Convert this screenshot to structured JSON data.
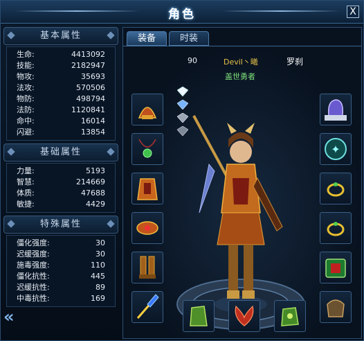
{
  "window": {
    "title": "角色",
    "close_label": "X"
  },
  "basic_attrs": {
    "header": "基本属性",
    "rows": [
      {
        "label": "生命:",
        "value": "4413092"
      },
      {
        "label": "技能:",
        "value": "2182947"
      },
      {
        "label": "物攻:",
        "value": "35693"
      },
      {
        "label": "法攻:",
        "value": "570506"
      },
      {
        "label": "物防:",
        "value": "498794"
      },
      {
        "label": "法防:",
        "value": "1120841"
      },
      {
        "label": "命中:",
        "value": "16014"
      },
      {
        "label": "闪避:",
        "value": "13854"
      }
    ]
  },
  "base_attrs": {
    "header": "基础属性",
    "rows": [
      {
        "label": "力量:",
        "value": "5193"
      },
      {
        "label": "智慧:",
        "value": "214669"
      },
      {
        "label": "体质:",
        "value": "47688"
      },
      {
        "label": "敏捷:",
        "value": "4429"
      }
    ]
  },
  "special_attrs": {
    "header": "特殊属性",
    "rows": [
      {
        "label": "僵化强度:",
        "value": "30"
      },
      {
        "label": "迟缓强度:",
        "value": "30"
      },
      {
        "label": "施毒强度:",
        "value": "110"
      },
      {
        "label": "僵化抗性:",
        "value": "445"
      },
      {
        "label": "迟缓抗性:",
        "value": "89"
      },
      {
        "label": "中毒抗性:",
        "value": "169"
      }
    ]
  },
  "tabs": [
    {
      "label": "装备",
      "active": true
    },
    {
      "label": "时装",
      "active": false
    }
  ],
  "character": {
    "level": "90",
    "name": "Devil丶曦",
    "job": "罗刹",
    "title": "盖世勇者"
  },
  "left_slots": [
    "helmet-icon",
    "necklace-icon",
    "armor-icon",
    "shoulder-icon",
    "boots-icon",
    "weapon-icon"
  ],
  "right_slots": [
    "mount-icon",
    "emblem-icon",
    "ring-icon",
    "ring-icon",
    "talisman-icon",
    "pouch-icon"
  ],
  "bottom_slots": [
    "bracer-icon",
    "wings-icon",
    "gauntlet-icon"
  ],
  "colors": {
    "accent": "#3d6690",
    "gold": "#f0c030",
    "name_yellow": "#e6c04a",
    "title_green": "#7ee07a"
  }
}
